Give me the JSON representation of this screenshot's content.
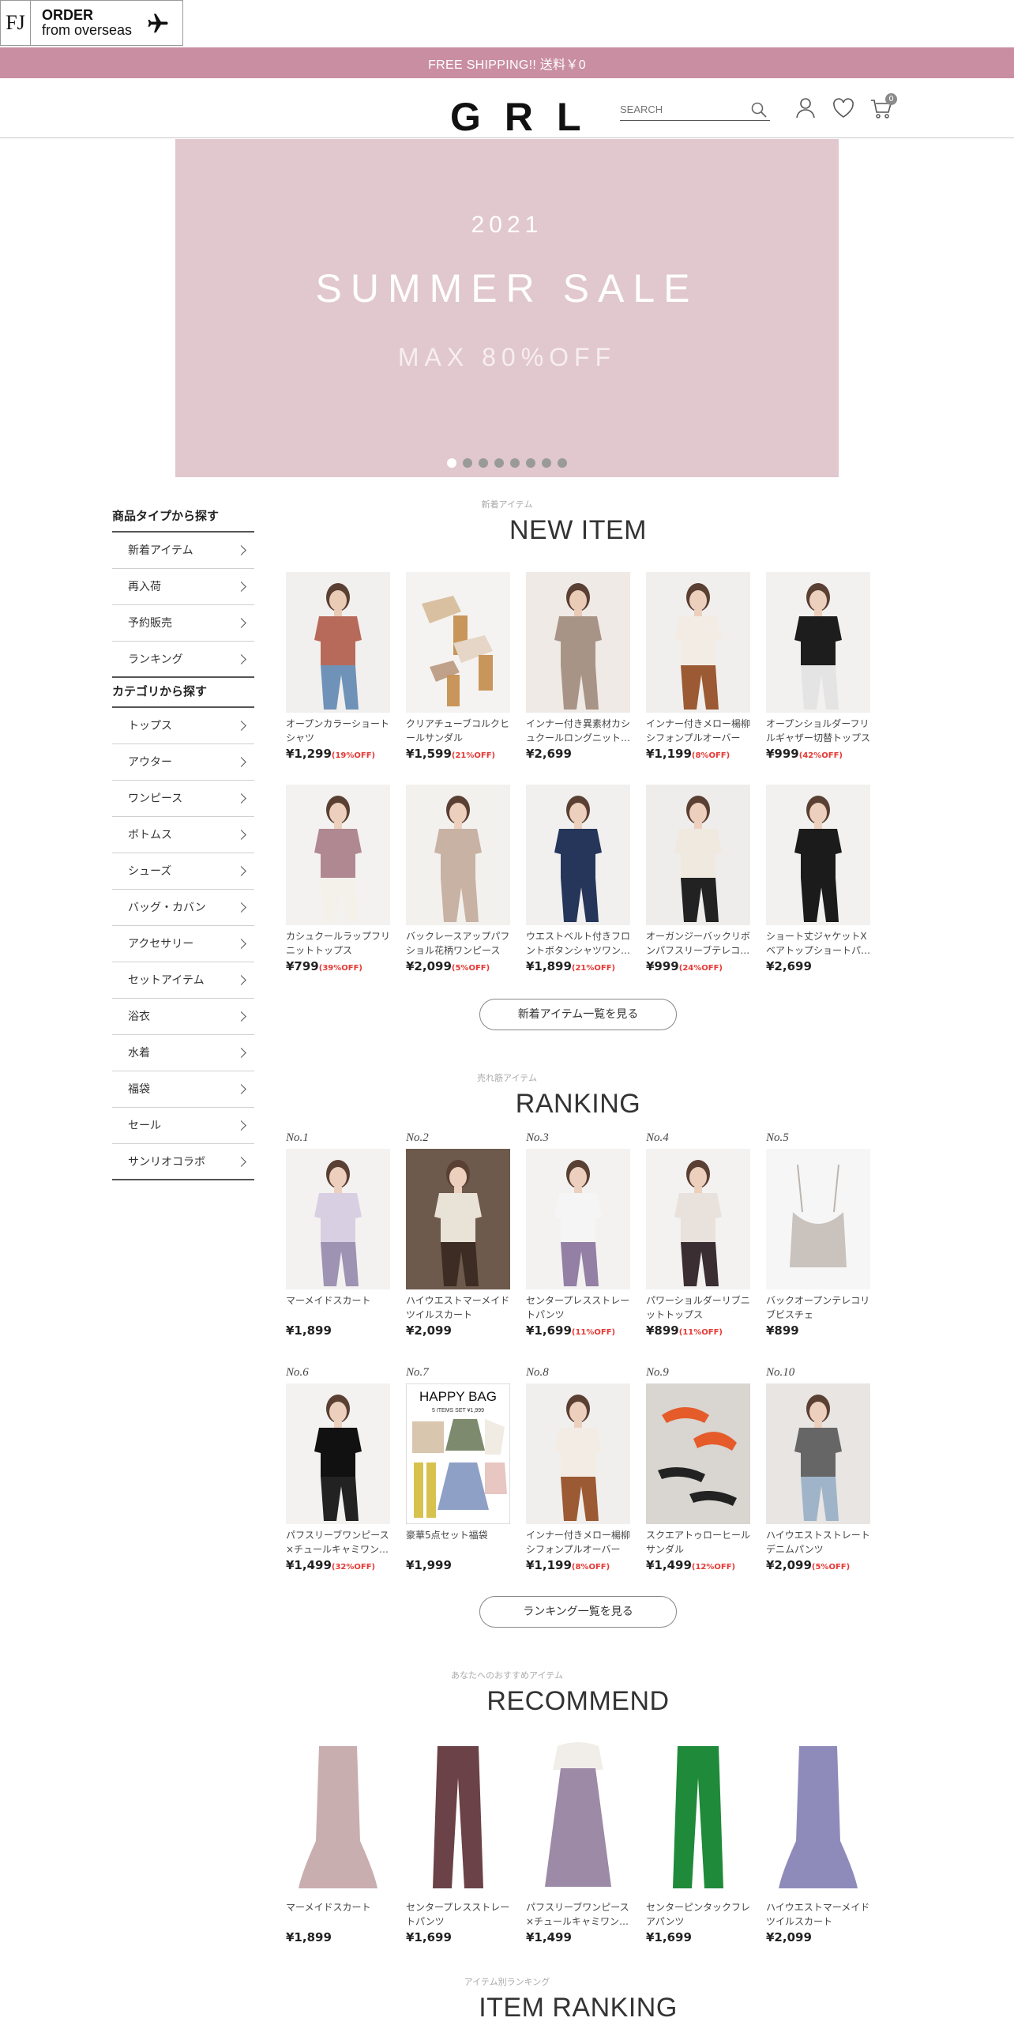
{
  "overseas": {
    "mark": "FJ",
    "line1": "ORDER",
    "line2": "from overseas"
  },
  "shipping_bar": "FREE SHIPPING!! 送料￥0",
  "header": {
    "logo": "GRL",
    "search_placeholder": "SEARCH",
    "cart_count": "0"
  },
  "hero": {
    "year": "2021",
    "title": "SUMMER SALE",
    "subtitle": "MAX 80%OFF",
    "slides": 8,
    "active_slide": 1
  },
  "sidebar": {
    "type_heading": "商品タイプから探す",
    "type_items": [
      "新着アイテム",
      "再入荷",
      "予約販売",
      "ランキング"
    ],
    "cat_heading": "カテゴリから探す",
    "cat_items": [
      "トップス",
      "アウター",
      "ワンピース",
      "ボトムス",
      "シューズ",
      "バッグ・カバン",
      "アクセサリー",
      "セットアイテム",
      "浴衣",
      "水着",
      "福袋",
      "セール",
      "サンリオコラボ"
    ]
  },
  "new_item": {
    "sub": "新着アイテム",
    "title": "NEW ITEM",
    "more": "新着アイテム一覧を見る",
    "items": [
      {
        "name": "オープンカラーショートシャツ",
        "price": "¥1,299",
        "disc": "(19%OFF)"
      },
      {
        "name": "クリアチューブコルクヒールサンダル",
        "price": "¥1,599",
        "disc": "(21%OFF)"
      },
      {
        "name": "インナー付き異素材カシュクールロングニット…",
        "price": "¥2,699",
        "disc": ""
      },
      {
        "name": "インナー付きメロー楊柳シフォンプルオーバー",
        "price": "¥1,199",
        "disc": "(8%OFF)"
      },
      {
        "name": "オープンショルダーフリルギャザー切替トップス",
        "price": "¥999",
        "disc": "(42%OFF)"
      },
      {
        "name": "カシュクールラップフリニットトップス",
        "price": "¥799",
        "disc": "(39%OFF)"
      },
      {
        "name": "バックレースアップパフショル花柄ワンピース",
        "price": "¥2,099",
        "disc": "(5%OFF)"
      },
      {
        "name": "ウエストベルト付きフロントボタンシャツワン…",
        "price": "¥1,899",
        "disc": "(21%OFF)"
      },
      {
        "name": "オーガンジーバックリボンパフスリーブテレコ…",
        "price": "¥999",
        "disc": "(24%OFF)"
      },
      {
        "name": "ショート丈ジャケットXベアトップショートパ…",
        "price": "¥2,699",
        "disc": ""
      }
    ]
  },
  "ranking": {
    "sub": "売れ筋アイテム",
    "title": "RANKING",
    "more": "ランキング一覧を見る",
    "items": [
      {
        "rank": "No.1",
        "name": "マーメイドスカート",
        "price": "¥1,899",
        "disc": ""
      },
      {
        "rank": "No.2",
        "name": "ハイウエストマーメイドツイルスカート",
        "price": "¥2,099",
        "disc": ""
      },
      {
        "rank": "No.3",
        "name": "センタープレスストレートパンツ",
        "price": "¥1,699",
        "disc": "(11%OFF)"
      },
      {
        "rank": "No.4",
        "name": "パワーショルダーリブニットトップス",
        "price": "¥899",
        "disc": "(11%OFF)"
      },
      {
        "rank": "No.5",
        "name": "バックオープンテレコリブビスチェ",
        "price": "¥899",
        "disc": ""
      },
      {
        "rank": "No.6",
        "name": "パフスリーブワンピース×チュールキャミワン…",
        "price": "¥1,499",
        "disc": "(32%OFF)"
      },
      {
        "rank": "No.7",
        "name": "豪華5点セット福袋",
        "price": "¥1,999",
        "disc": "",
        "banner": "HAPPY BAG",
        "banner_sub": "5 ITEMS SET ¥1,999"
      },
      {
        "rank": "No.8",
        "name": "インナー付きメロー楊柳シフォンプルオーバー",
        "price": "¥1,199",
        "disc": "(8%OFF)"
      },
      {
        "rank": "No.9",
        "name": "スクエアトゥローヒールサンダル",
        "price": "¥1,499",
        "disc": "(12%OFF)"
      },
      {
        "rank": "No.10",
        "name": "ハイウエストストレートデニムパンツ",
        "price": "¥2,099",
        "disc": "(5%OFF)"
      }
    ]
  },
  "recommend": {
    "sub": "あなたへのおすすめアイテム",
    "title": "RECOMMEND",
    "items": [
      {
        "name": "マーメイドスカート",
        "price": "¥1,899"
      },
      {
        "name": "センタープレスストレートパンツ",
        "price": "¥1,699"
      },
      {
        "name": "パフスリーブワンピース×チュールキャミワン…",
        "price": "¥1,499"
      },
      {
        "name": "センターピンタックフレアパンツ",
        "price": "¥1,699"
      },
      {
        "name": "ハイウエストマーメイドツイルスカート",
        "price": "¥2,099"
      }
    ]
  },
  "item_ranking": {
    "sub": "アイテム別ランキング",
    "title": "ITEM RANKING"
  },
  "colors": {
    "shipping_bar": "#c98ea2",
    "hero_bg": "#e1c7ce",
    "discount": "#e53935"
  }
}
